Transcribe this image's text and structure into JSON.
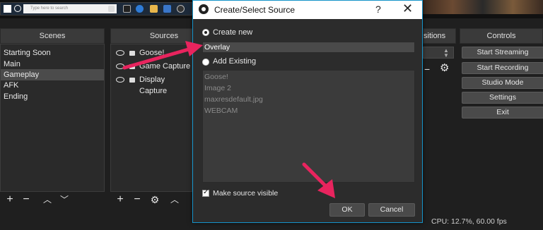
{
  "taskbar": {
    "search_placeholder": "Type here to search"
  },
  "scenes": {
    "header": "Scenes",
    "items": [
      "Starting Soon",
      "Main",
      "Gameplay",
      "AFK",
      "Ending"
    ],
    "selected_index": 2
  },
  "sources": {
    "header": "Sources",
    "items": [
      "Goose!",
      "Game Capture",
      "Display Capture"
    ]
  },
  "transitions": {
    "header_fragment": "sitions"
  },
  "controls": {
    "header": "Controls",
    "buttons": [
      "Start Streaming",
      "Start Recording",
      "Studio Mode",
      "Settings",
      "Exit"
    ]
  },
  "status": {
    "cpu": "CPU: 12.7%, 60.00 fps"
  },
  "dialog": {
    "title": "Create/Select Source",
    "help": "?",
    "close": "✕",
    "create_new_label": "Create new",
    "name_value": "Overlay",
    "add_existing_label": "Add Existing",
    "existing_items": [
      "Goose!",
      "Image 2",
      "maxresdefault.jpg",
      "WEBCAM"
    ],
    "visible_label": "Make source visible",
    "visible_checked": true,
    "ok_label": "OK",
    "cancel_label": "Cancel"
  },
  "colors": {
    "accent": "#1593c9",
    "arrow": "#e8245e"
  }
}
